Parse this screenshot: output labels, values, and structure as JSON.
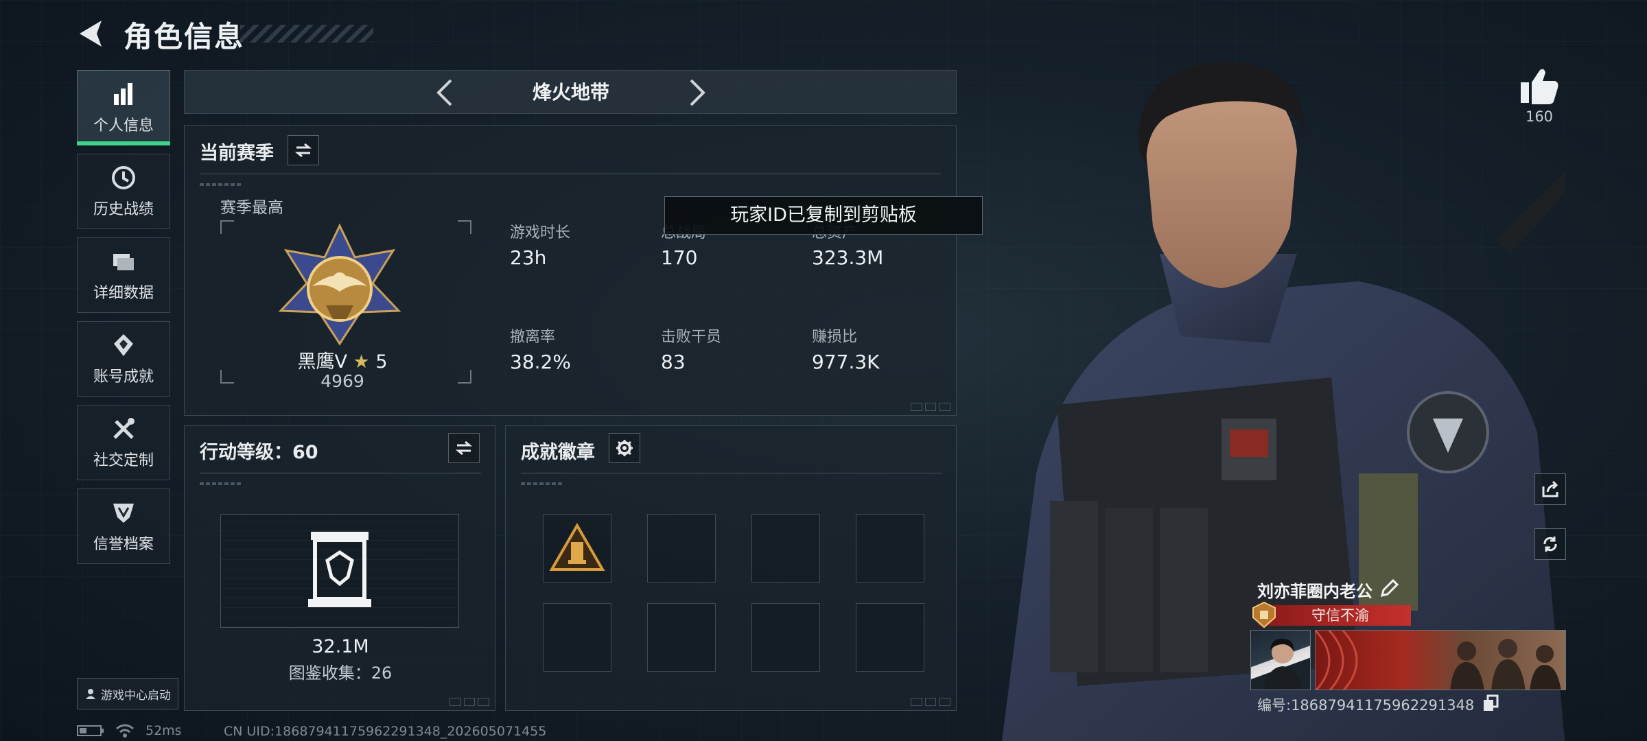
{
  "header": {
    "title": "角色信息"
  },
  "nav": {
    "items": [
      {
        "label": "个人信息",
        "icon": "bar-chart-icon",
        "active": true
      },
      {
        "label": "历史战绩",
        "icon": "clock-icon",
        "active": false
      },
      {
        "label": "详细数据",
        "icon": "folder-icon",
        "active": false
      },
      {
        "label": "账号成就",
        "icon": "achievement-icon",
        "active": false
      },
      {
        "label": "社交定制",
        "icon": "wrench-icon",
        "active": false
      },
      {
        "label": "信誉档案",
        "icon": "shield-icon",
        "active": false
      }
    ],
    "launch_label": "游戏中心启动"
  },
  "mode": {
    "name": "烽火地带"
  },
  "season": {
    "title": "当前赛季",
    "best_label": "赛季最高",
    "rank_name": "黑鹰V",
    "rank_stars": "5",
    "rank_score": "4969",
    "stats": [
      {
        "label": "游戏时长",
        "value": "23h"
      },
      {
        "label": "总战局",
        "value": "170"
      },
      {
        "label": "总资产",
        "value": "323.3M"
      },
      {
        "label": "撤离率",
        "value": "38.2%"
      },
      {
        "label": "击败干员",
        "value": "83"
      },
      {
        "label": "赚损比",
        "value": "977.3K"
      }
    ]
  },
  "action_level": {
    "title": "行动等级：60",
    "value": "32.1M",
    "collection": "图鉴收集：26"
  },
  "achievements": {
    "title": "成就徽章",
    "filled_slots": 1,
    "total_slots": 8
  },
  "toast": {
    "text": "玩家ID已复制到剪贴板"
  },
  "profile": {
    "likes": "160",
    "player_name": "刘亦菲圈内老公",
    "reputation": "守信不渝",
    "id_text": "编号:18687941175962291348"
  },
  "status": {
    "ping": "52ms",
    "uid": "CN UID:18687941175962291348_202605071455"
  },
  "colors": {
    "accent_green": "#3fd28a",
    "reputation_red": "#c5302c",
    "panel_border": "#3b4851"
  }
}
